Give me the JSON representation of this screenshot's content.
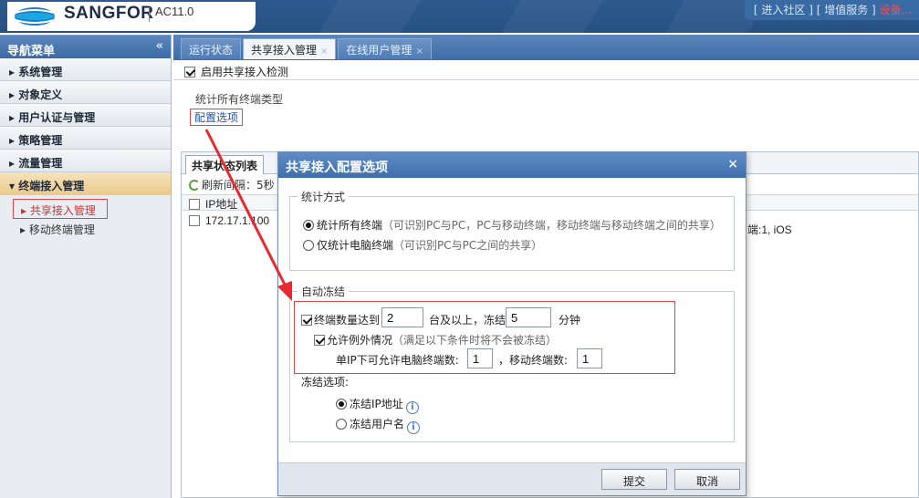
{
  "header": {
    "brand": "SANGFOR",
    "model": "AC11.0",
    "links": [
      "[ 进入社区 ]",
      "[ 增值服务 ]"
    ],
    "links_suffix": "设备..."
  },
  "sidebar": {
    "title": "导航菜单",
    "collapse_icon": "«",
    "items": [
      {
        "label": "系统管理",
        "expanded": false
      },
      {
        "label": "对象定义",
        "expanded": false
      },
      {
        "label": "用户认证与管理",
        "expanded": false
      },
      {
        "label": "策略管理",
        "expanded": false
      },
      {
        "label": "流量管理",
        "expanded": false
      },
      {
        "label": "终端接入管理",
        "expanded": true
      }
    ],
    "subitems": [
      {
        "label": "共享接入管理",
        "active": true
      },
      {
        "label": "移动终端管理",
        "active": false
      }
    ],
    "bullet_closed": "▸",
    "bullet_open": "▾"
  },
  "tabs": [
    {
      "label": "运行状态",
      "closable": false
    },
    {
      "label": "共享接入管理",
      "closable": true,
      "active": true
    },
    {
      "label": "在线用户管理",
      "closable": true
    }
  ],
  "main": {
    "enable_label": "启用共享接入检测",
    "stat_type_label": "统计所有终端类型",
    "config_link": "配置选项",
    "panel_tab": "共享状态列表",
    "refresh_label": "刷新间隔：5秒",
    "column_ip": "IP地址",
    "rows": [
      {
        "ip": "172.17.1.100",
        "tail": "端:1, iOS"
      }
    ]
  },
  "dialog": {
    "title": "共享接入配置选项",
    "close_icon": "×",
    "stat_method_legend": "统计方式",
    "opt_all": "统计所有终端",
    "opt_all_hint": "（可识别PC与PC，PC与移动终端，移动终端与移动终端之间的共享）",
    "opt_pc": "仅统计电脑终端",
    "opt_pc_hint": "（可识别PC与PC之间的共享）",
    "selected_stat": "all",
    "auto_freeze_legend": "自动冻结",
    "term_count_label": "终端数量达到",
    "term_count": "2",
    "freeze_mid": "台及以上，冻结",
    "freeze_minutes": "5",
    "minutes_unit": "分钟",
    "term_count_checked": true,
    "exception_label": "允许例外情况",
    "exception_hint": "（满足以下条件时将不会被冻结）",
    "exception_checked": true,
    "pc_per_ip_label": "单IP下可允许电脑终端数:",
    "pc_per_ip": "1",
    "mobile_label": "，移动终端数:",
    "mobile_count": "1",
    "freeze_options_label": "冻结选项:",
    "freeze_ip": "冻结IP地址",
    "freeze_user": "冻结用户名",
    "freeze_selected": "ip",
    "info_icon": "i",
    "submit": "提交",
    "cancel": "取消"
  },
  "colors": {
    "accent": "#3f6fac",
    "highlight": "#e04545",
    "arrow": "#e8282c"
  }
}
